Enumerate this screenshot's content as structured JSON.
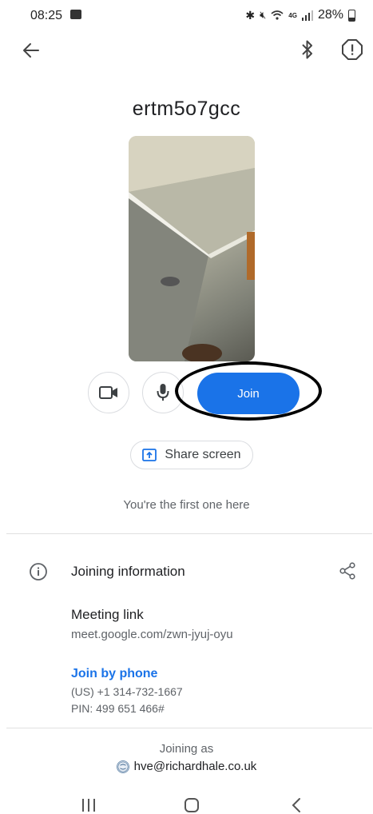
{
  "status_bar": {
    "time": "08:25",
    "network_label": "4G",
    "battery": "28%"
  },
  "header": {
    "meeting_code": "ertm5o7gcc"
  },
  "controls": {
    "join_label": "Join",
    "share_label": "Share screen",
    "status_text": "You're the first one here"
  },
  "info": {
    "title": "Joining information",
    "meeting_link_label": "Meeting link",
    "meeting_link": "meet.google.com/zwn-jyuj-oyu",
    "join_phone_label": "Join by phone",
    "phone_number": "(US) +1 314-732-1667",
    "pin": "PIN: 499 651 466#"
  },
  "account": {
    "joining_as_label": "Joining as",
    "email": "hve@richardhale.co.uk"
  },
  "colors": {
    "accent": "#1a73e8",
    "annotation": "#000000"
  }
}
